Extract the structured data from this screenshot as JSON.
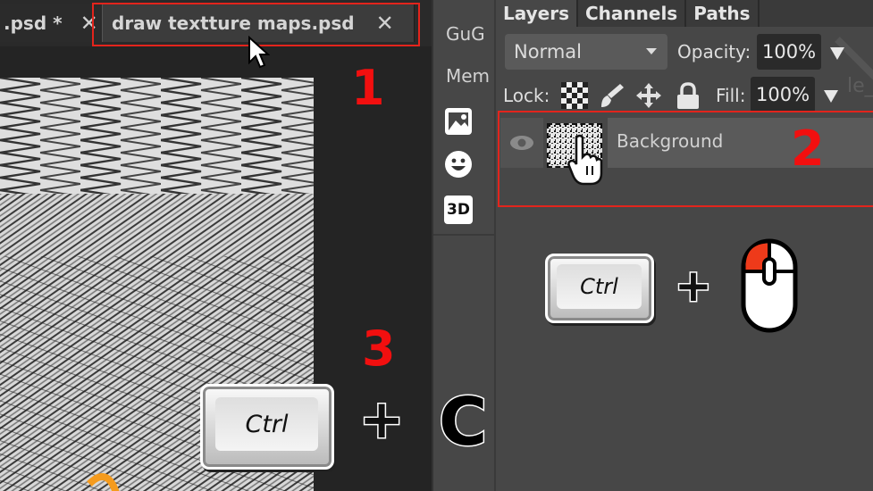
{
  "document_tabs": [
    {
      "label": ".psd *",
      "close_glyph": "✕",
      "active": false
    },
    {
      "label": "draw textture maps.psd",
      "close_glyph": "✕",
      "active": true
    }
  ],
  "annotations": {
    "step1": "1",
    "step2": "2",
    "step3": "3",
    "highlight_color": "#e3241c",
    "number_color": "#f20f0f"
  },
  "toolbar": {
    "items": [
      {
        "label": "GuG"
      },
      {
        "label": "Mem"
      },
      {
        "icon": "image-icon"
      },
      {
        "icon": "emoji-icon"
      },
      {
        "icon": "3d-icon",
        "label": "3D"
      }
    ]
  },
  "layers_panel": {
    "tabs": [
      {
        "label": "Layers",
        "active": true
      },
      {
        "label": "Channels",
        "active": false
      },
      {
        "label": "Paths",
        "active": false
      }
    ],
    "blend_mode": "Normal",
    "opacity_label": "Opacity:",
    "opacity_value": "100%",
    "lock_label": "Lock:",
    "fill_label": "Fill:",
    "fill_value": "100%",
    "ghost_text": "le_s",
    "layers": [
      {
        "name": "Background",
        "visible": true
      }
    ]
  },
  "shortcuts": {
    "select_layer": {
      "key": "Ctrl",
      "plus": "+",
      "mouse": "left-click"
    },
    "copy": {
      "key": "Ctrl",
      "plus": "+",
      "letter": "C"
    }
  }
}
